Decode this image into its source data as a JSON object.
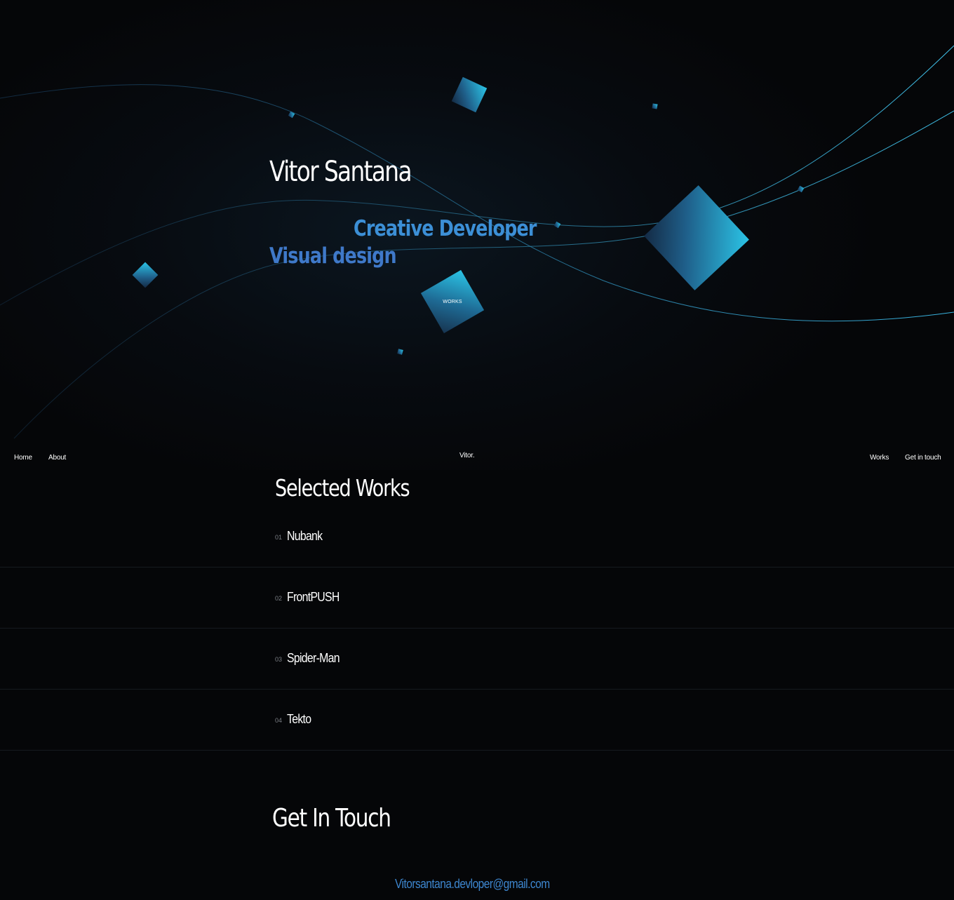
{
  "hero": {
    "name": "Vitor Santana",
    "role_primary": "Creative Developer",
    "role_secondary": "Visual design",
    "works_cube_label": "WORKS"
  },
  "nav": {
    "home": "Home",
    "about": "About",
    "logo": "Vitor.",
    "works": "Works",
    "contact": "Get in touch"
  },
  "works": {
    "title": "Selected Works",
    "items": [
      {
        "num": "01",
        "name": "Nubank"
      },
      {
        "num": "02",
        "name": "FrontPUSH"
      },
      {
        "num": "03",
        "name": "Spider-Man"
      },
      {
        "num": "04",
        "name": "Tekto"
      }
    ]
  },
  "contact": {
    "title": "Get In Touch",
    "email": "Vitorsantana.devloper@gmail.com"
  },
  "colors": {
    "background": "#050608",
    "accent": "#3d86cf",
    "cube_light": "#2bc4e6",
    "cube_dark": "#142a44"
  }
}
